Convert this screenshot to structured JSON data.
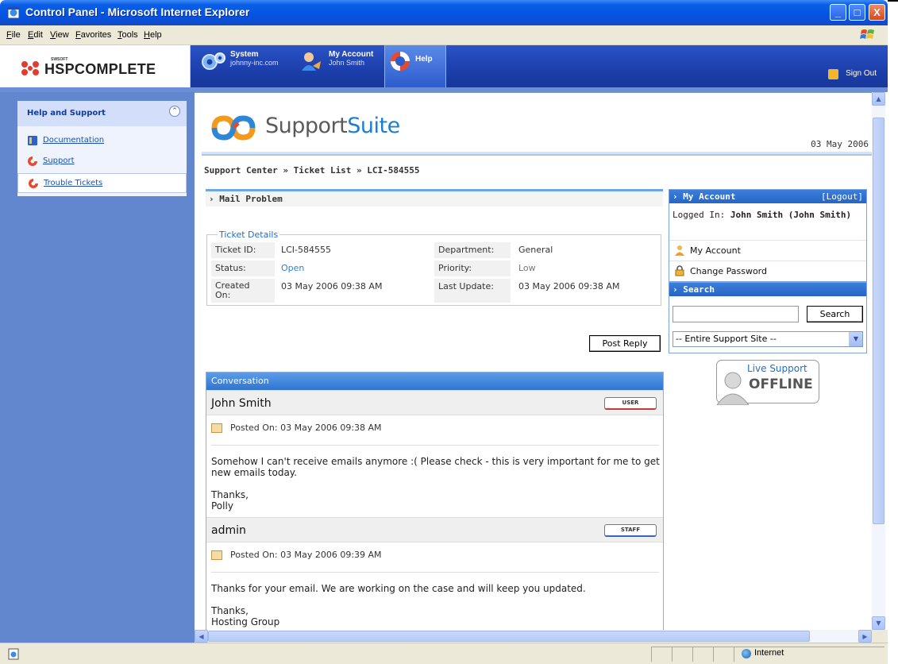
{
  "window": {
    "title": "Control Panel - Microsoft Internet Explorer",
    "controls": {
      "minimize": "_",
      "maximize": "□",
      "close": "X"
    }
  },
  "menubar": {
    "items": [
      "File",
      "Edit",
      "View",
      "Favorites",
      "Tools",
      "Help"
    ]
  },
  "appheader": {
    "logo": {
      "small": "SWSOFT",
      "name": "HSPCOMPLETE"
    },
    "tabs": [
      {
        "title": "System",
        "subtitle": "johnny-inc.com",
        "icon": "gears-icon"
      },
      {
        "title": "My Account",
        "subtitle": "John Smith",
        "icon": "user-icon"
      },
      {
        "title": "Help",
        "subtitle": "",
        "icon": "lifebuoy-icon"
      }
    ],
    "signout": "Sign Out"
  },
  "sidebar": {
    "title": "Help and Support",
    "items": [
      {
        "label": "Documentation",
        "icon": "book-icon"
      },
      {
        "label": "Support",
        "icon": "lifebuoy-icon"
      },
      {
        "label": "Trouble Tickets",
        "icon": "lifebuoy-icon",
        "active": true
      }
    ]
  },
  "support": {
    "brand_1": "Support",
    "brand_2": "Suite",
    "date": "03 May 2006",
    "breadcrumb": "Support Center » Ticket List » LCI-584555",
    "subject": "Mail Problem",
    "details": {
      "legend": "Ticket Details",
      "ticket_id_label": "Ticket ID:",
      "ticket_id": "LCI-584555",
      "department_label": "Department:",
      "department": "General",
      "status_label": "Status:",
      "status": "Open",
      "priority_label": "Priority:",
      "priority": "Low",
      "created_label": "Created On:",
      "created": "03 May 2006 09:38 AM",
      "updated_label": "Last Update:",
      "updated": "03 May 2006 09:38 AM"
    },
    "post_reply": "Post Reply",
    "conversation": {
      "title": "Conversation",
      "messages": [
        {
          "author": "John Smith",
          "role": "USER",
          "posted": "Posted On: 03 May 2006 09:38 AM",
          "body_1": "Somehow I can't receive emails anymore :( Please check - this is very important for me to get new emails today.",
          "body_2": "Thanks,",
          "body_3": "Polly"
        },
        {
          "author": "admin",
          "role": "STAFF",
          "posted": "Posted On: 03 May 2006 09:39 AM",
          "body_1": "Thanks for your email. We are working on the case and will keep you updated.",
          "body_2": "Thanks,",
          "body_3": "Hosting Group"
        }
      ]
    }
  },
  "account_box": {
    "title": "My Account",
    "logout": "[Logout]",
    "logged_in_prefix": "Logged In: ",
    "logged_in_user": "John Smith (John Smith)",
    "links": [
      {
        "label": "My Account",
        "icon": "user-icon"
      },
      {
        "label": "Change Password",
        "icon": "lock-icon"
      }
    ]
  },
  "search_box": {
    "title": "Search",
    "input_value": "",
    "button": "Search",
    "scope": "-- Entire Support Site --"
  },
  "live_support": {
    "line1": "Live Support",
    "line2": "OFFLINE"
  },
  "statusbar": {
    "zone": "Internet"
  }
}
